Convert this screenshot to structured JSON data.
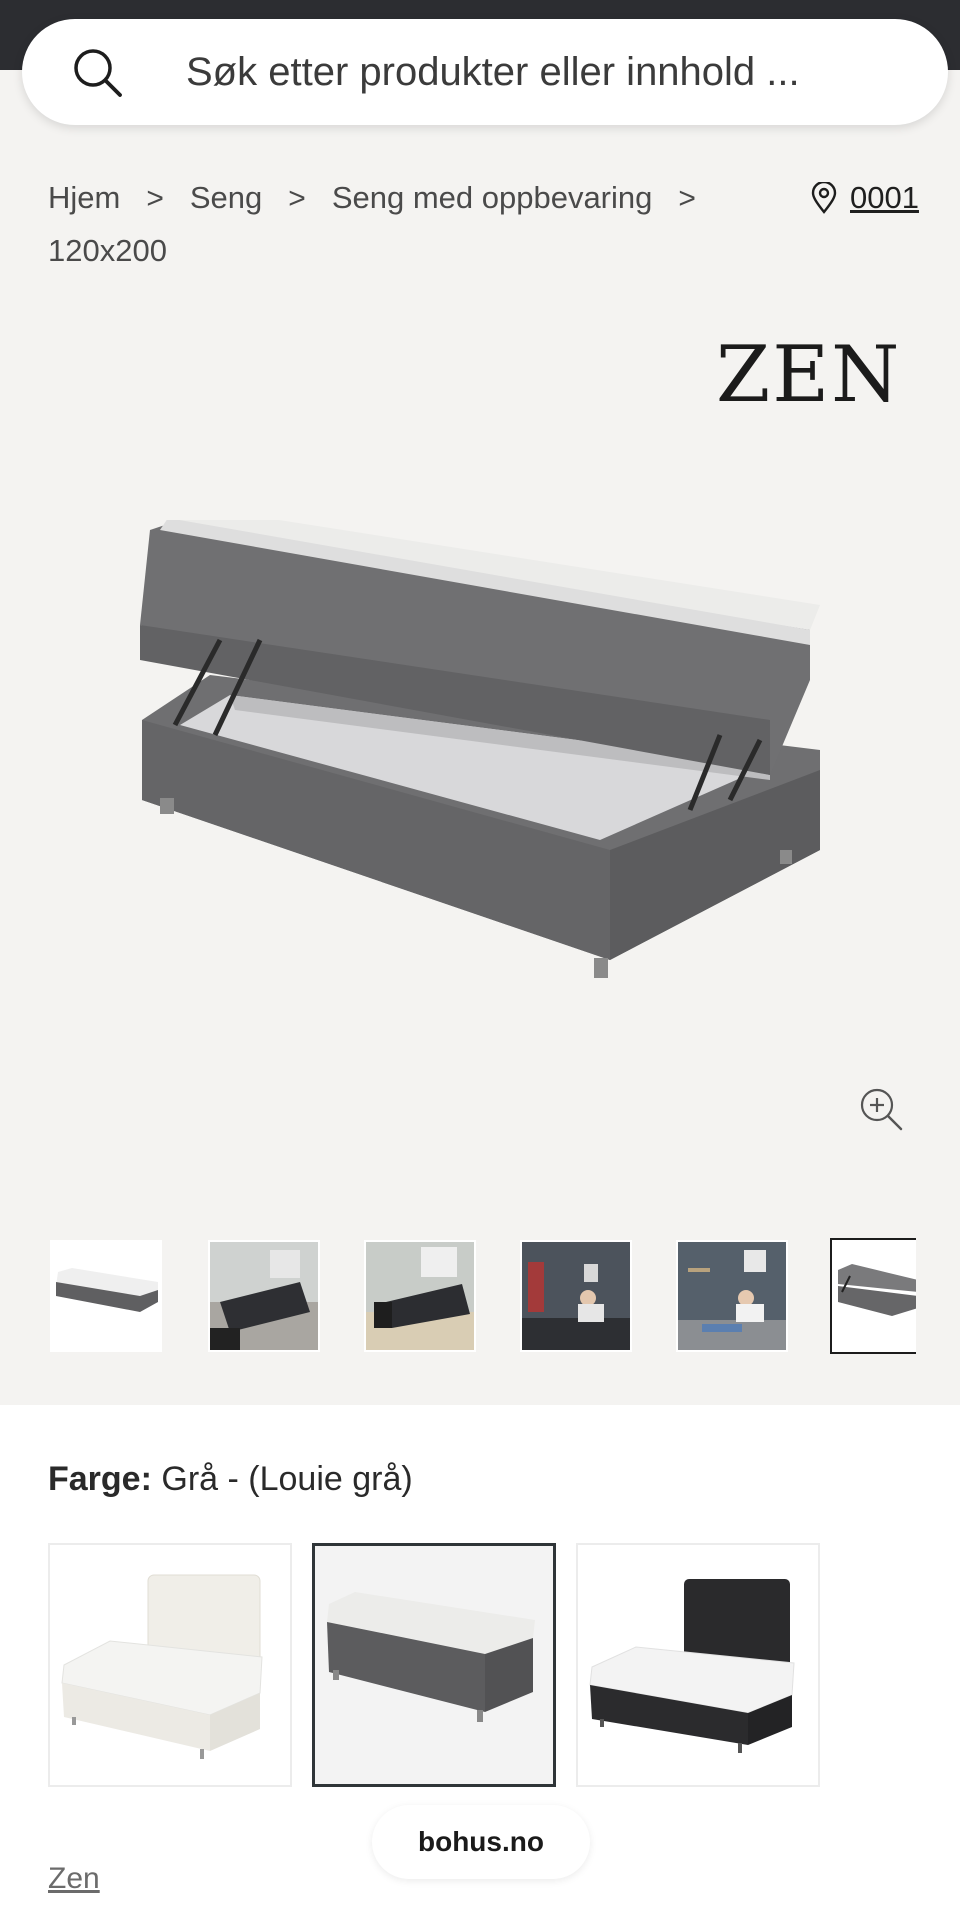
{
  "search": {
    "placeholder": "Søk etter produkter eller innhold ...",
    "icon": "search-icon"
  },
  "breadcrumb": {
    "items": [
      "Hjem",
      "Seng",
      "Seng med oppbevaring",
      "120x200"
    ],
    "separator": ">"
  },
  "store": {
    "icon": "location-pin-icon",
    "label": "0001"
  },
  "product": {
    "brand_logo": "ZEN",
    "image_alt": "Seng med oppbevaring, grå, med løftet sengebunn",
    "thumbnails": [
      "thumb-1",
      "thumb-2",
      "thumb-3",
      "thumb-4",
      "thumb-5",
      "thumb-6"
    ],
    "active_thumbnail": 6
  },
  "color": {
    "label": "Farge:",
    "value": "Grå - (Louie grå)",
    "options": [
      "Hvit",
      "Grå",
      "Svart"
    ],
    "selected": 1
  },
  "brand_link": "Zen",
  "site_badge": "bohus.no",
  "colors": {
    "topbar": "#2c2d31",
    "page_bg": "#f4f3f1",
    "bed_gray": "#6e6e70"
  }
}
